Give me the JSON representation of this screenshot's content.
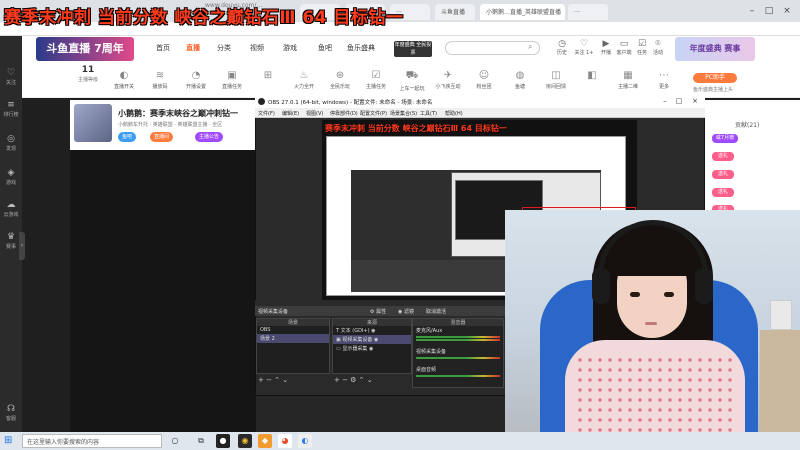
{
  "overlay": {
    "title": "赛季末冲刺 当前分数 峡谷之巅钻石Ⅲ 64 目标钻一"
  },
  "browser": {
    "tabs": [
      "…",
      "…",
      "…",
      "斗鱼直播",
      "小鹅鹅…直播_英雄联盟直播",
      "…"
    ],
    "address": "www.douyu.com/…"
  },
  "sidebar": {
    "items": [
      {
        "icon": "heart-icon",
        "label": "关注"
      },
      {
        "icon": "list-icon",
        "label": "排行榜"
      },
      {
        "icon": "compass-icon",
        "label": "发现"
      },
      {
        "icon": "gamepad-icon",
        "label": "游戏"
      },
      {
        "icon": "cloud-game-icon",
        "label": "云游戏"
      },
      {
        "icon": "trophy-icon",
        "label": "赛事"
      },
      {
        "icon": "headset-icon",
        "label": "客服"
      }
    ]
  },
  "site": {
    "logo_text": "斗鱼直播 7周年",
    "nav": [
      "首页",
      "直播",
      "分类",
      "视频",
      "游戏",
      "鱼吧",
      "鱼乐盛典"
    ],
    "active_nav": "直播",
    "promo_badge": "年度盛典 全民投票",
    "search_placeholder": "",
    "header_icons": [
      {
        "icon": "history-icon",
        "label": "历史"
      },
      {
        "icon": "follow-icon",
        "label": "关注 1+"
      },
      {
        "icon": "live-icon",
        "label": "开播"
      },
      {
        "icon": "client-icon",
        "label": "客户端"
      },
      {
        "icon": "task-icon",
        "label": "任务"
      },
      {
        "icon": "location-icon",
        "label": "活动"
      }
    ],
    "banner_right": "年度盛典 赛事"
  },
  "toolstrip": {
    "follow_count": "11",
    "follow_label": "主播等级",
    "tools": [
      "直播开关",
      "播放码",
      "开播设置",
      "直播任务",
      "",
      "火力全开",
      "全民乐玩",
      "主播任务",
      "上车一起玩",
      "小飞侠互动",
      "粉丝团",
      "鱼塘",
      "房间回馈",
      "",
      "主播二维",
      "更多"
    ],
    "pc_badge": "PC助手",
    "pc_sub": "鱼乐盛典主播上头"
  },
  "room": {
    "title": "小鹅鹅：赛季末峡谷之巅冲刺钻一",
    "tags": "小鹅鹅车升托 · 英雄联盟 · 英雄联盟主播 · 全区",
    "buttons": [
      "鱼吧",
      "直播间",
      "主播公告"
    ]
  },
  "obs": {
    "title": "OBS 27.0.1 (64-bit, windows) - 配置文件: 未命名 - 场景: 未命名",
    "menu": [
      "文件(F)",
      "编辑(E)",
      "视图(V)",
      "停靠部件(D)",
      "配置文件(P)",
      "场景集合(S)",
      "工具(T)",
      "帮助(H)"
    ],
    "nested_title": "赛季末冲刺 当前分数 峡谷之巅钻石Ⅲ 64 目标钻一",
    "panel_bar": [
      "视频采集设备",
      "属性",
      "滤镜",
      "取消激活"
    ],
    "scenes_header": "场景",
    "scenes": [
      "OBS",
      "场景 2"
    ],
    "sources_header": "来源",
    "sources": [
      "文本 (GDI+)",
      "视频采集设备",
      "显示器采集"
    ],
    "mixer_header": "混音器",
    "mixer": [
      "麦克风/Aux",
      "视频采集设备",
      "桌面音频"
    ]
  },
  "rpanel": {
    "header": "贡献(21)",
    "pills": [
      "或7月榜",
      "送礼",
      "送礼",
      "送礼",
      "送礼"
    ]
  },
  "taskbar": {
    "search_placeholder": "在这里输入你要搜索的内容"
  },
  "colors": {
    "accent": "#ff5d23",
    "obs_bg": "#2a2a2a",
    "chair_blue": "#2b67c8",
    "overlay_red": "#ff3b1f"
  }
}
